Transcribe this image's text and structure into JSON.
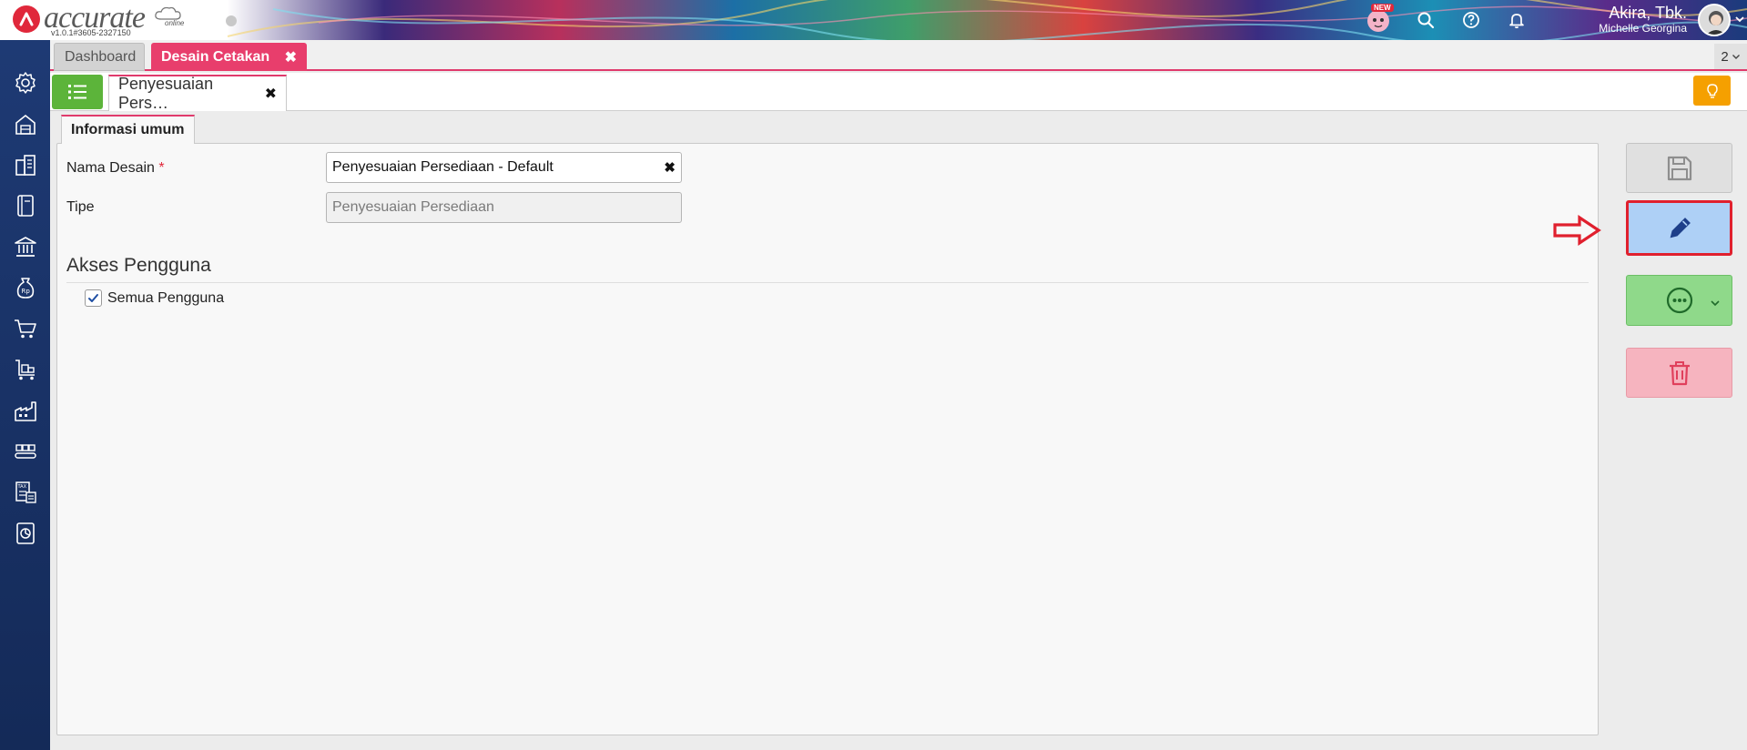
{
  "header": {
    "logo_text": "accurate",
    "logo_sub": "online",
    "version": "v1.0.1#3605-2327150",
    "new_badge": "NEW",
    "company_name": "Akira, Tbk.",
    "user_name": "Michelle Georgina"
  },
  "sidebar": {
    "items": [
      "settings-icon",
      "warehouse-icon",
      "company-icon",
      "ledger-icon",
      "bank-icon",
      "money-bag-icon",
      "cart-icon",
      "trolley-icon",
      "factory-icon",
      "conveyor-icon",
      "tax-icon",
      "report-icon"
    ]
  },
  "tabs": {
    "dashboard": "Dashboard",
    "desain_cetakan": "Desain Cetakan",
    "close": "✖",
    "count": "2"
  },
  "subtab": {
    "label": "Penyesuaian Pers…",
    "close": "✖"
  },
  "form": {
    "section_tab": "Informasi umum",
    "nama_desain_label": "Nama Desain",
    "required_mark": "*",
    "nama_desain_value": "Penyesuaian Persediaan - Default",
    "clear": "✖",
    "tipe_label": "Tipe",
    "tipe_value": "Penyesuaian Persediaan",
    "akses_title": "Akses Pengguna",
    "semua_pengguna_label": "Semua Pengguna",
    "semua_pengguna_checked": true
  },
  "actions": [
    "save",
    "edit",
    "more",
    "delete"
  ],
  "colors": {
    "accent_pink": "#e83e6c",
    "sidebar_blue": "#1e3a74",
    "list_green": "#5cb43a",
    "tip_orange": "#f5a000",
    "edit_blue": "#aed0f6",
    "highlight_red": "#e0202e"
  }
}
